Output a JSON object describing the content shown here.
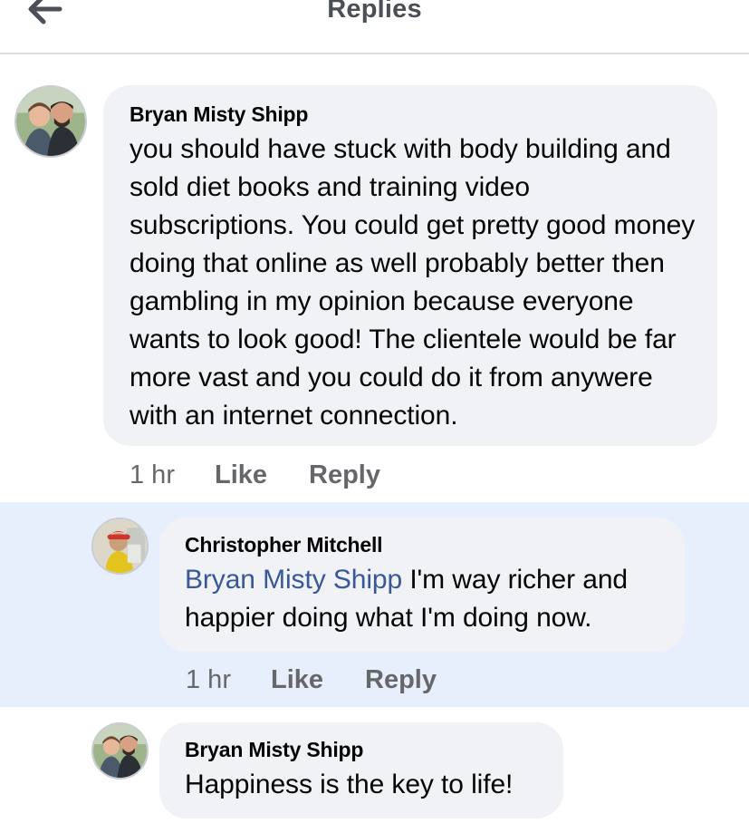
{
  "header": {
    "title": "Replies",
    "back_icon": "arrow-left-icon"
  },
  "colors": {
    "bubble_bg": "#f0f2f5",
    "highlight_bg": "#e7effc",
    "mention": "#385898",
    "meta_text": "#65676b"
  },
  "comments": [
    {
      "author": "Bryan Misty Shipp",
      "mention": "",
      "text": "you should have stuck with body building and sold diet books and training video subscriptions. You could get pretty good money doing that online as well probably better then gambling in my opinion because everyone wants to look good! The clientele would be far more vast and you could do it from anywere with an internet connection.",
      "time": "1 hr",
      "like_label": "Like",
      "reply_label": "Reply"
    },
    {
      "author": "Christopher Mitchell",
      "mention": "Bryan Misty Shipp",
      "text": "I'm way richer and happier doing what I'm doing now.",
      "time": "1 hr",
      "like_label": "Like",
      "reply_label": "Reply"
    },
    {
      "author": "Bryan Misty Shipp",
      "mention": "",
      "text": "Happiness is the key to life!",
      "time": "",
      "like_label": "",
      "reply_label": ""
    }
  ]
}
